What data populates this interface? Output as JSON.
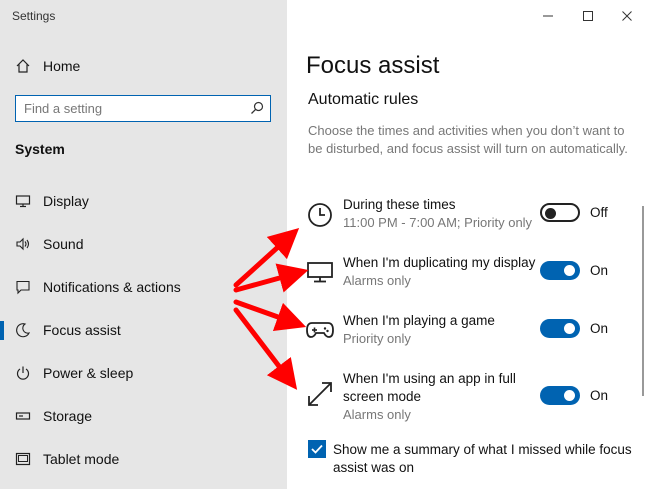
{
  "window": {
    "title": "Settings",
    "controls": [
      "minimize",
      "maximize",
      "close"
    ]
  },
  "sidebar": {
    "home_label": "Home",
    "search_placeholder": "Find a setting",
    "section_label": "System",
    "items": [
      {
        "label": "Display",
        "icon": "monitor-icon"
      },
      {
        "label": "Sound",
        "icon": "speaker-icon"
      },
      {
        "label": "Notifications & actions",
        "icon": "notification-icon"
      },
      {
        "label": "Focus assist",
        "icon": "moon-icon",
        "active": true
      },
      {
        "label": "Power & sleep",
        "icon": "power-icon"
      },
      {
        "label": "Storage",
        "icon": "storage-icon"
      },
      {
        "label": "Tablet mode",
        "icon": "tablet-icon"
      }
    ]
  },
  "main": {
    "title": "Focus assist",
    "subheading": "Automatic rules",
    "description": "Choose the times and activities when you don’t want to be disturbed, and focus assist will turn on automatically.",
    "rules": [
      {
        "title": "During these times",
        "subtitle": "11:00 PM - 7:00 AM; Priority only",
        "state": "Off",
        "on": false,
        "icon": "clock-icon"
      },
      {
        "title": "When I'm duplicating my display",
        "subtitle": "Alarms only",
        "state": "On",
        "on": true,
        "icon": "display-icon"
      },
      {
        "title": "When I'm playing a game",
        "subtitle": "Priority only",
        "state": "On",
        "on": true,
        "icon": "gamepad-icon"
      },
      {
        "title_line1": "When I'm using an app in full",
        "title_line2": "screen mode",
        "subtitle": "Alarms only",
        "state": "On",
        "on": true,
        "icon": "fullscreen-icon"
      }
    ],
    "summary_checkbox": {
      "label": "Show me a summary of what I missed while focus assist was on",
      "checked": true
    }
  },
  "colors": {
    "accent": "#0063b1",
    "sidebar_bg": "#e6e6e6",
    "annotation_arrow": "#ff0000"
  }
}
